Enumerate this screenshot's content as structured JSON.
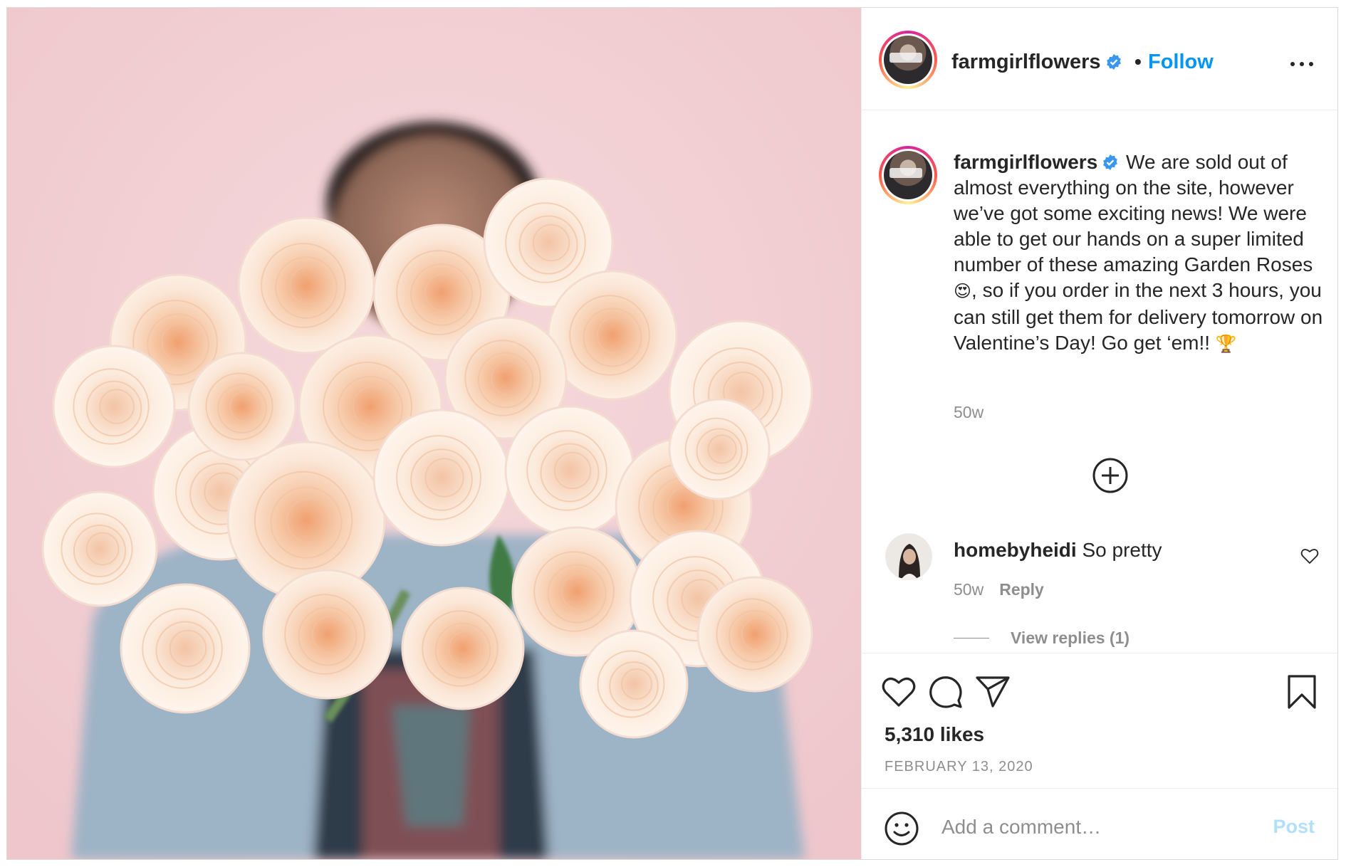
{
  "header": {
    "username": "farmgirlflowers",
    "separator": "•",
    "follow_label": "Follow",
    "more_icon": "more-options-icon",
    "verified_color": "#3897f0"
  },
  "caption": {
    "username": "farmgirlflowers",
    "text_part1": " We are sold out of almost everything on the site, however we’ve got some exciting news! We were able to get our hands on a super limited number of these amazing Garden Roses",
    "emoji1": "😍",
    "text_part2": ", so if you order in the next 3 hours, you can still get them for delivery tomorrow on Valentine’s Day! Go get ‘em!! ",
    "emoji2": "🏆",
    "time": "50w"
  },
  "load_more_icon": "plus-circle-icon",
  "comment": {
    "username": "homebyheidi",
    "text": " So pretty",
    "time": "50w",
    "reply_label": "Reply",
    "view_replies_label": "View replies (1)"
  },
  "actions": {
    "like_icon": "heart-icon",
    "comment_icon": "comment-icon",
    "share_icon": "share-icon",
    "save_icon": "bookmark-icon",
    "likes": "5,310 likes",
    "date": "FEBRUARY 13, 2020"
  },
  "add_comment": {
    "placeholder": "Add a comment…",
    "post_label": "Post",
    "emoji_icon": "emoji-icon"
  },
  "colors": {
    "link": "#0095f6",
    "muted": "#8e8e8e",
    "photo_background": "#f1cfd3",
    "post_disabled": "#b2dffc"
  }
}
